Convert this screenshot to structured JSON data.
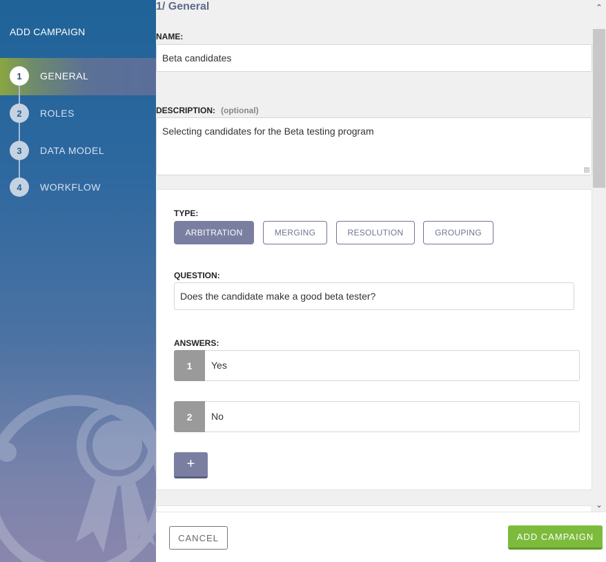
{
  "sidebar": {
    "title": "ADD CAMPAIGN",
    "steps": [
      {
        "number": "1",
        "label": "GENERAL",
        "active": true
      },
      {
        "number": "2",
        "label": "ROLES",
        "active": false
      },
      {
        "number": "3",
        "label": "DATA MODEL",
        "active": false
      },
      {
        "number": "4",
        "label": "WORKFLOW",
        "active": false
      }
    ],
    "decoration_icon": "award-ribbon-icon"
  },
  "main": {
    "section_heading": "1/ General",
    "name": {
      "label": "NAME:",
      "value": "Beta candidates"
    },
    "description": {
      "label": "DESCRIPTION:",
      "optional_label": "(optional)",
      "value": "Selecting candidates for the Beta testing program"
    },
    "type": {
      "label": "TYPE:",
      "options": [
        "ARBITRATION",
        "MERGING",
        "RESOLUTION",
        "GROUPING"
      ],
      "selected": "ARBITRATION"
    },
    "question": {
      "label": "QUESTION:",
      "value": "Does the candidate make a good beta tester?"
    },
    "answers": {
      "label": "ANSWERS:",
      "items": [
        {
          "number": "1",
          "value": "Yes"
        },
        {
          "number": "2",
          "value": "No"
        }
      ],
      "add_label": "+"
    }
  },
  "footer": {
    "cancel_label": "CANCEL",
    "submit_label": "ADD CAMPAIGN"
  },
  "colors": {
    "sidebar_top": "#1f6398",
    "sidebar_bottom": "#8a86ad",
    "accent": "#7a7fa2",
    "submit": "#7cbb3c",
    "heading": "#5e6a8a"
  }
}
